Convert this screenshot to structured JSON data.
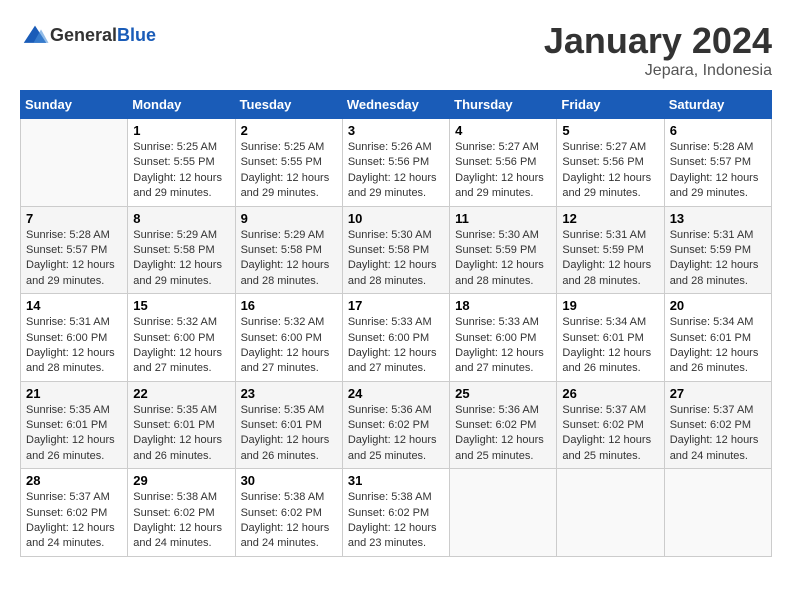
{
  "header": {
    "logo_general": "General",
    "logo_blue": "Blue",
    "month": "January 2024",
    "location": "Jepara, Indonesia"
  },
  "days_of_week": [
    "Sunday",
    "Monday",
    "Tuesday",
    "Wednesday",
    "Thursday",
    "Friday",
    "Saturday"
  ],
  "weeks": [
    [
      {
        "day": "",
        "info": ""
      },
      {
        "day": "1",
        "info": "Sunrise: 5:25 AM\nSunset: 5:55 PM\nDaylight: 12 hours\nand 29 minutes."
      },
      {
        "day": "2",
        "info": "Sunrise: 5:25 AM\nSunset: 5:55 PM\nDaylight: 12 hours\nand 29 minutes."
      },
      {
        "day": "3",
        "info": "Sunrise: 5:26 AM\nSunset: 5:56 PM\nDaylight: 12 hours\nand 29 minutes."
      },
      {
        "day": "4",
        "info": "Sunrise: 5:27 AM\nSunset: 5:56 PM\nDaylight: 12 hours\nand 29 minutes."
      },
      {
        "day": "5",
        "info": "Sunrise: 5:27 AM\nSunset: 5:56 PM\nDaylight: 12 hours\nand 29 minutes."
      },
      {
        "day": "6",
        "info": "Sunrise: 5:28 AM\nSunset: 5:57 PM\nDaylight: 12 hours\nand 29 minutes."
      }
    ],
    [
      {
        "day": "7",
        "info": "Sunrise: 5:28 AM\nSunset: 5:57 PM\nDaylight: 12 hours\nand 29 minutes."
      },
      {
        "day": "8",
        "info": "Sunrise: 5:29 AM\nSunset: 5:58 PM\nDaylight: 12 hours\nand 29 minutes."
      },
      {
        "day": "9",
        "info": "Sunrise: 5:29 AM\nSunset: 5:58 PM\nDaylight: 12 hours\nand 28 minutes."
      },
      {
        "day": "10",
        "info": "Sunrise: 5:30 AM\nSunset: 5:58 PM\nDaylight: 12 hours\nand 28 minutes."
      },
      {
        "day": "11",
        "info": "Sunrise: 5:30 AM\nSunset: 5:59 PM\nDaylight: 12 hours\nand 28 minutes."
      },
      {
        "day": "12",
        "info": "Sunrise: 5:31 AM\nSunset: 5:59 PM\nDaylight: 12 hours\nand 28 minutes."
      },
      {
        "day": "13",
        "info": "Sunrise: 5:31 AM\nSunset: 5:59 PM\nDaylight: 12 hours\nand 28 minutes."
      }
    ],
    [
      {
        "day": "14",
        "info": "Sunrise: 5:31 AM\nSunset: 6:00 PM\nDaylight: 12 hours\nand 28 minutes."
      },
      {
        "day": "15",
        "info": "Sunrise: 5:32 AM\nSunset: 6:00 PM\nDaylight: 12 hours\nand 27 minutes."
      },
      {
        "day": "16",
        "info": "Sunrise: 5:32 AM\nSunset: 6:00 PM\nDaylight: 12 hours\nand 27 minutes."
      },
      {
        "day": "17",
        "info": "Sunrise: 5:33 AM\nSunset: 6:00 PM\nDaylight: 12 hours\nand 27 minutes."
      },
      {
        "day": "18",
        "info": "Sunrise: 5:33 AM\nSunset: 6:00 PM\nDaylight: 12 hours\nand 27 minutes."
      },
      {
        "day": "19",
        "info": "Sunrise: 5:34 AM\nSunset: 6:01 PM\nDaylight: 12 hours\nand 26 minutes."
      },
      {
        "day": "20",
        "info": "Sunrise: 5:34 AM\nSunset: 6:01 PM\nDaylight: 12 hours\nand 26 minutes."
      }
    ],
    [
      {
        "day": "21",
        "info": "Sunrise: 5:35 AM\nSunset: 6:01 PM\nDaylight: 12 hours\nand 26 minutes."
      },
      {
        "day": "22",
        "info": "Sunrise: 5:35 AM\nSunset: 6:01 PM\nDaylight: 12 hours\nand 26 minutes."
      },
      {
        "day": "23",
        "info": "Sunrise: 5:35 AM\nSunset: 6:01 PM\nDaylight: 12 hours\nand 26 minutes."
      },
      {
        "day": "24",
        "info": "Sunrise: 5:36 AM\nSunset: 6:02 PM\nDaylight: 12 hours\nand 25 minutes."
      },
      {
        "day": "25",
        "info": "Sunrise: 5:36 AM\nSunset: 6:02 PM\nDaylight: 12 hours\nand 25 minutes."
      },
      {
        "day": "26",
        "info": "Sunrise: 5:37 AM\nSunset: 6:02 PM\nDaylight: 12 hours\nand 25 minutes."
      },
      {
        "day": "27",
        "info": "Sunrise: 5:37 AM\nSunset: 6:02 PM\nDaylight: 12 hours\nand 24 minutes."
      }
    ],
    [
      {
        "day": "28",
        "info": "Sunrise: 5:37 AM\nSunset: 6:02 PM\nDaylight: 12 hours\nand 24 minutes."
      },
      {
        "day": "29",
        "info": "Sunrise: 5:38 AM\nSunset: 6:02 PM\nDaylight: 12 hours\nand 24 minutes."
      },
      {
        "day": "30",
        "info": "Sunrise: 5:38 AM\nSunset: 6:02 PM\nDaylight: 12 hours\nand 24 minutes."
      },
      {
        "day": "31",
        "info": "Sunrise: 5:38 AM\nSunset: 6:02 PM\nDaylight: 12 hours\nand 23 minutes."
      },
      {
        "day": "",
        "info": ""
      },
      {
        "day": "",
        "info": ""
      },
      {
        "day": "",
        "info": ""
      }
    ]
  ]
}
